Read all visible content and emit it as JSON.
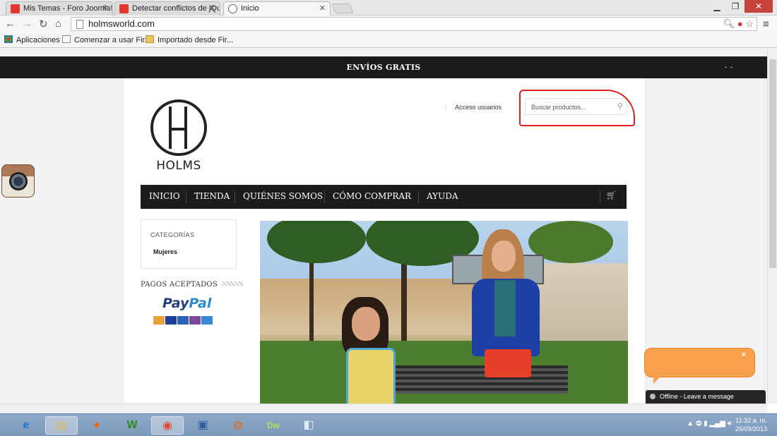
{
  "browser": {
    "tabs": [
      {
        "label": "Mis Temas - Foro Joomla!"
      },
      {
        "label": "Detectar conflictos de jQu"
      },
      {
        "label": "Inicio"
      }
    ],
    "url": "holmsworld.com",
    "bookmarks": [
      "Aplicaciones",
      "Comenzar a usar Fir...",
      "Importado desde Fir..."
    ]
  },
  "page": {
    "shipping_banner": "ENVÍOS GRATIS",
    "logo_text": "HOLMS",
    "access_link": "Acceso usuarios",
    "search_placeholder": "Buscar productos...",
    "nav": [
      "INICIO",
      "TIENDA",
      "QUIÉNES SOMOS",
      "CÓMO COMPRAR",
      "AYUDA"
    ],
    "categories_heading": "CATEGORÍAS",
    "categories": [
      "Mujeres"
    ],
    "payments_heading": "PAGOS ACEPTADOS",
    "paypal": {
      "part1": "Pay",
      "part2": "Pal"
    },
    "chat_status": "Offline - Leave a message"
  },
  "taskbar": {
    "time": "11:32 a. m.",
    "date": "26/09/2013"
  }
}
